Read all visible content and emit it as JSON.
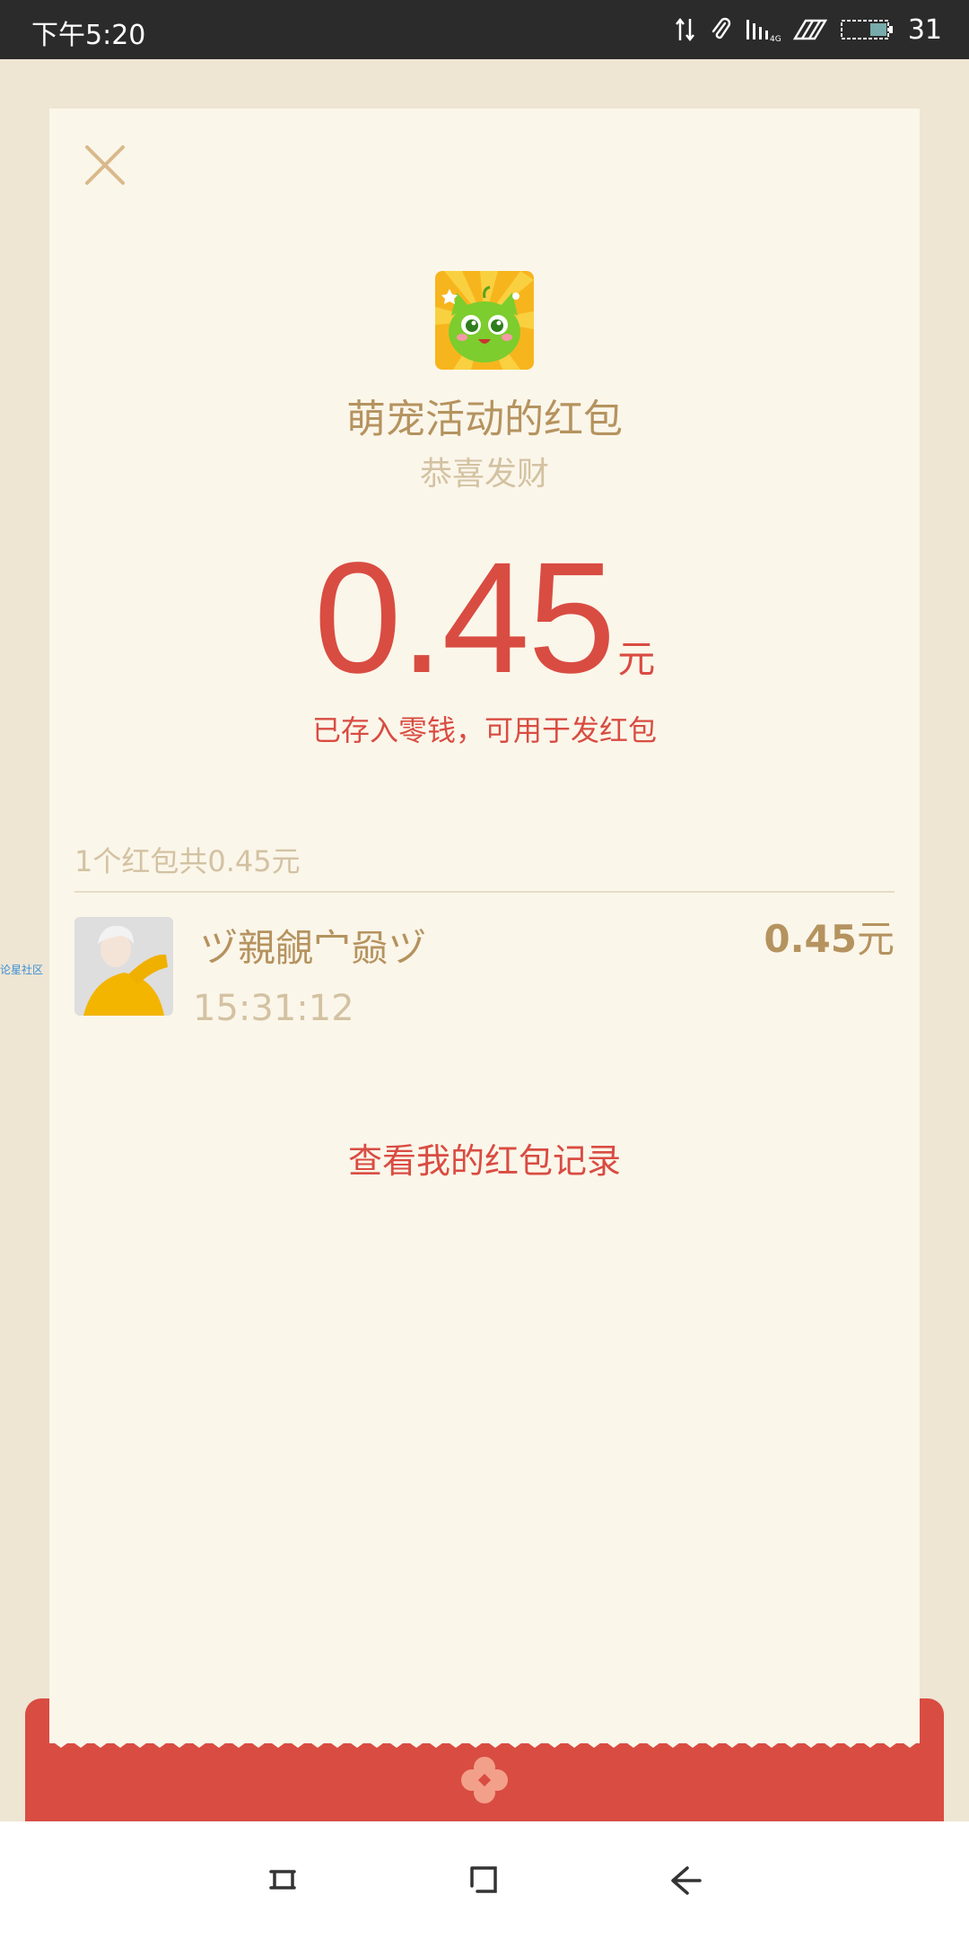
{
  "status_bar": {
    "time": "下午5:20",
    "battery_level": "31",
    "network_label": "4G"
  },
  "card": {
    "title": "萌宠活动的红包",
    "greeting": "恭喜发财",
    "amount": "0.45",
    "amount_unit": "元",
    "stored_note": "已存入零钱，可用于发红包",
    "summary": "1个红包共0.45元",
    "receivers": [
      {
        "name": "ヅ親覦宀赑ヅ",
        "time": "15:31:12",
        "amount": "0.45",
        "unit": "元"
      }
    ],
    "history_link": "查看我的红包记录"
  },
  "side_watermark": "论星社区",
  "colors": {
    "accent_red": "#d94c42",
    "gold_text": "#b5935f",
    "muted_text": "#d3c2a2",
    "card_bg": "#fbf6ea",
    "page_bg": "#eee5d3"
  }
}
